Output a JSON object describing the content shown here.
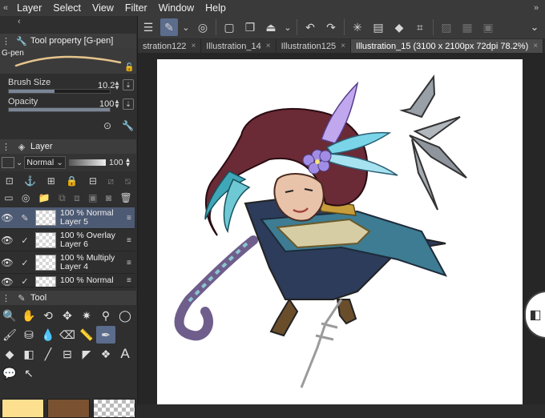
{
  "menu": [
    "Layer",
    "Select",
    "View",
    "Filter",
    "Window",
    "Help"
  ],
  "toolbar": {
    "icons": [
      "menu-icon",
      "pen-tool-icon",
      "chevron-down-icon",
      "stamp-icon",
      "new-layer-icon",
      "copy-icon",
      "fill-icon",
      "chevron-down-icon",
      "undo-icon",
      "redo-icon",
      "loading-icon",
      "transform-icon",
      "clear-icon",
      "crop-icon",
      "grid-icon",
      "frame-icon",
      "window-icon"
    ]
  },
  "tabs": [
    {
      "label": "stration122",
      "close": "×"
    },
    {
      "label": "Illustration_14",
      "close": "×"
    },
    {
      "label": "Illustration125",
      "close": "×"
    },
    {
      "label": "Illustration_15 (3100 x 2100px 72dpi 78.2%)",
      "close": "×"
    }
  ],
  "tool_property": {
    "title": "Tool property [G-pen]",
    "brush_name": "G-pen",
    "brush_size_label": "Brush Size",
    "brush_size_value": "10.2",
    "brush_size_fraction": 0.45,
    "opacity_label": "Opacity",
    "opacity_value": "100",
    "opacity_fraction": 1.0
  },
  "layer_panel": {
    "title": "Layer",
    "blend_mode": "Normal",
    "opacity_value": "100",
    "layers": [
      {
        "mode": "100 % Normal",
        "name": "Layer 5",
        "selected": true
      },
      {
        "mode": "100 % Overlay",
        "name": "Layer 6",
        "selected": false
      },
      {
        "mode": "100 % Multiply",
        "name": "Layer 4",
        "selected": false
      },
      {
        "mode": "100 % Normal",
        "name": "",
        "selected": false
      }
    ]
  },
  "tool_panel": {
    "title": "Tool",
    "tools": [
      "zoom",
      "hand",
      "rotate",
      "move",
      "magic",
      "picker",
      "lasso",
      "pen",
      "blend",
      "dropper",
      "eraser",
      "ruler",
      "fill-brush",
      "pencil",
      "fill",
      "gradient",
      "line",
      "frame",
      "shape",
      "pattern",
      "text",
      "balloon",
      "selection"
    ]
  },
  "colors": {
    "accent": "#5b6c8c",
    "main_color": "#fde08f",
    "sub_color": "#7a5232"
  }
}
